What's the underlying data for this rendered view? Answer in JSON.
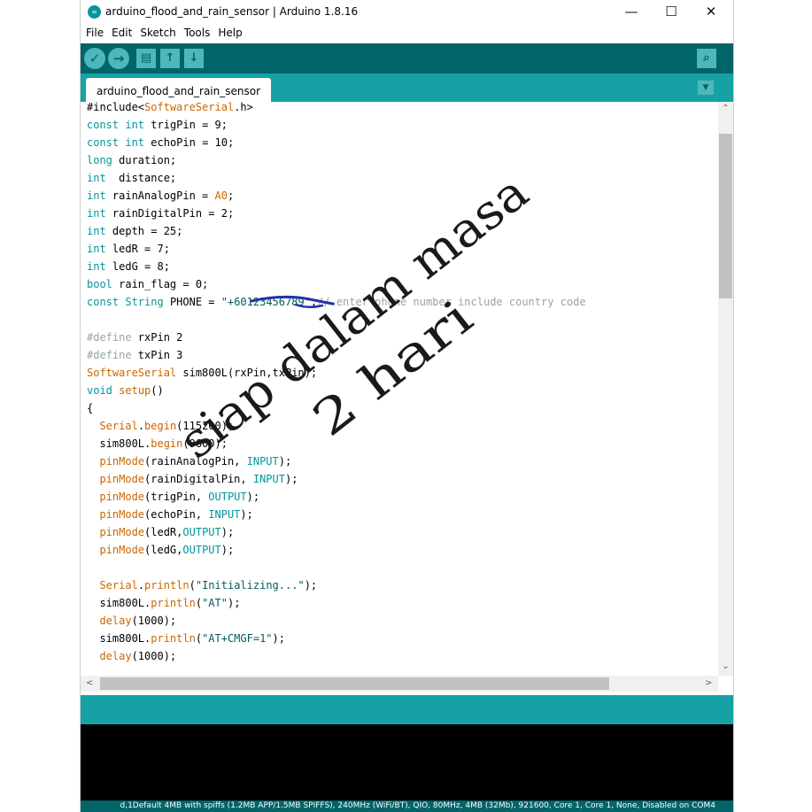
{
  "window": {
    "icon": "arduino-logo-icon",
    "icon_glyph": "∞",
    "title": "arduino_flood_and_rain_sensor | Arduino 1.8.16",
    "controls": {
      "minimize": "—",
      "maximize": "☐",
      "close": "✕"
    }
  },
  "menu": {
    "items": [
      "File",
      "Edit",
      "Sketch",
      "Tools",
      "Help"
    ]
  },
  "toolbar": {
    "buttons": [
      {
        "name": "verify",
        "icon": "checkmark-icon",
        "glyph": "✓"
      },
      {
        "name": "upload",
        "icon": "arrow-right-icon",
        "glyph": "→"
      },
      {
        "name": "new",
        "icon": "new-file-icon",
        "glyph": "▤"
      },
      {
        "name": "open",
        "icon": "arrow-up-icon",
        "glyph": "↑"
      },
      {
        "name": "save",
        "icon": "arrow-down-icon",
        "glyph": "↓"
      }
    ],
    "serial_monitor": {
      "icon": "serial-monitor-magnifier-icon",
      "glyph": "⌕"
    }
  },
  "tabs": {
    "active": "arduino_flood_and_rain_sensor",
    "dropdown_glyph": "▼"
  },
  "colors": {
    "keyword": "#00979c",
    "type_class": "#cc6600",
    "string": "#005c5f",
    "comment": "#95a5a6",
    "toolbar_bg": "#006468",
    "tabbar_bg": "#17a1a5",
    "ink": "#1a1a1a",
    "blue_ink": "#2233aa"
  },
  "editor": {
    "lines": [
      [
        [
          "#include<",
          "d"
        ],
        [
          "SoftwareSerial",
          "o"
        ],
        [
          ".h>",
          "d"
        ]
      ],
      [
        [
          "const",
          "k"
        ],
        [
          " ",
          "d"
        ],
        [
          "int",
          "k"
        ],
        [
          " trigPin = 9;",
          "d"
        ]
      ],
      [
        [
          "const",
          "k"
        ],
        [
          " ",
          "d"
        ],
        [
          "int",
          "k"
        ],
        [
          " echoPin = 10;",
          "d"
        ]
      ],
      [
        [
          "long",
          "k"
        ],
        [
          " duration;",
          "d"
        ]
      ],
      [
        [
          "int",
          "k"
        ],
        [
          "  distance;",
          "d"
        ]
      ],
      [
        [
          "int",
          "k"
        ],
        [
          " rainAnalogPin = ",
          "d"
        ],
        [
          "A0",
          "o"
        ],
        [
          ";",
          "d"
        ]
      ],
      [
        [
          "int",
          "k"
        ],
        [
          " rainDigitalPin = 2;",
          "d"
        ]
      ],
      [
        [
          "int",
          "k"
        ],
        [
          " depth = 25;",
          "d"
        ]
      ],
      [
        [
          "int",
          "k"
        ],
        [
          " ledR = 7;",
          "d"
        ]
      ],
      [
        [
          "int",
          "k"
        ],
        [
          " ledG = 8;",
          "d"
        ]
      ],
      [
        [
          "bool",
          "k"
        ],
        [
          " rain_flag = 0;",
          "d"
        ]
      ],
      [
        [
          "const",
          "k"
        ],
        [
          " ",
          "d"
        ],
        [
          "String",
          "k"
        ],
        [
          " PHONE = ",
          "d"
        ],
        [
          "\"+60123456789\"",
          "s"
        ],
        [
          ";",
          "d"
        ],
        [
          "// enter phone number include country code",
          "c"
        ]
      ],
      [],
      [
        [
          "#define",
          "c"
        ],
        [
          " rxPin 2",
          "d"
        ]
      ],
      [
        [
          "#define",
          "c"
        ],
        [
          " txPin 3",
          "d"
        ]
      ],
      [
        [
          "SoftwareSerial",
          "o"
        ],
        [
          " sim800L(rxPin,txPin);",
          "d"
        ]
      ],
      [
        [
          "void",
          "k"
        ],
        [
          " ",
          "d"
        ],
        [
          "setup",
          "o"
        ],
        [
          "()",
          "d"
        ]
      ],
      [
        [
          "{",
          "d"
        ]
      ],
      [
        [
          "  ",
          "d"
        ],
        [
          "Serial",
          "o"
        ],
        [
          ".",
          "d"
        ],
        [
          "begin",
          "o"
        ],
        [
          "(115200);",
          "d"
        ]
      ],
      [
        [
          "  sim800L.",
          "d"
        ],
        [
          "begin",
          "o"
        ],
        [
          "(9600);",
          "d"
        ]
      ],
      [
        [
          "  ",
          "d"
        ],
        [
          "pinMode",
          "o"
        ],
        [
          "(rainAnalogPin, ",
          "d"
        ],
        [
          "INPUT",
          "k"
        ],
        [
          ");",
          "d"
        ]
      ],
      [
        [
          "  ",
          "d"
        ],
        [
          "pinMode",
          "o"
        ],
        [
          "(rainDigitalPin, ",
          "d"
        ],
        [
          "INPUT",
          "k"
        ],
        [
          ");",
          "d"
        ]
      ],
      [
        [
          "  ",
          "d"
        ],
        [
          "pinMode",
          "o"
        ],
        [
          "(trigPin, ",
          "d"
        ],
        [
          "OUTPUT",
          "k"
        ],
        [
          ");",
          "d"
        ]
      ],
      [
        [
          "  ",
          "d"
        ],
        [
          "pinMode",
          "o"
        ],
        [
          "(echoPin, ",
          "d"
        ],
        [
          "INPUT",
          "k"
        ],
        [
          ");",
          "d"
        ]
      ],
      [
        [
          "  ",
          "d"
        ],
        [
          "pinMode",
          "o"
        ],
        [
          "(ledR,",
          "d"
        ],
        [
          "OUTPUT",
          "k"
        ],
        [
          ");",
          "d"
        ]
      ],
      [
        [
          "  ",
          "d"
        ],
        [
          "pinMode",
          "o"
        ],
        [
          "(ledG,",
          "d"
        ],
        [
          "OUTPUT",
          "k"
        ],
        [
          ");",
          "d"
        ]
      ],
      [],
      [
        [
          "  ",
          "d"
        ],
        [
          "Serial",
          "o"
        ],
        [
          ".",
          "d"
        ],
        [
          "println",
          "o"
        ],
        [
          "(",
          "d"
        ],
        [
          "\"Initializing...\"",
          "s"
        ],
        [
          ");",
          "d"
        ]
      ],
      [
        [
          "  sim800L.",
          "d"
        ],
        [
          "println",
          "o"
        ],
        [
          "(",
          "d"
        ],
        [
          "\"AT\"",
          "s"
        ],
        [
          ");",
          "d"
        ]
      ],
      [
        [
          "  ",
          "d"
        ],
        [
          "delay",
          "o"
        ],
        [
          "(1000);",
          "d"
        ]
      ],
      [
        [
          "  sim800L.",
          "d"
        ],
        [
          "println",
          "o"
        ],
        [
          "(",
          "d"
        ],
        [
          "\"AT+CMGF=1\"",
          "s"
        ],
        [
          ");",
          "d"
        ]
      ],
      [
        [
          "  ",
          "d"
        ],
        [
          "delay",
          "o"
        ],
        [
          "(1000);",
          "d"
        ]
      ]
    ]
  },
  "scrollbars": {
    "up": "⌃",
    "down": "⌄",
    "left": "<",
    "right": ">"
  },
  "status": {
    "board": "d,1Default 4MB with spiffs (1.2MB APP/1.5MB SPIFFS), 240MHz (WiFi/BT), QIO, 80MHz, 4MB (32Mb), 921600, Core 1, Core 1, None, Disabled on COM4"
  },
  "handwriting": {
    "line1": "siap dalam masa",
    "line2": "2 hari"
  }
}
